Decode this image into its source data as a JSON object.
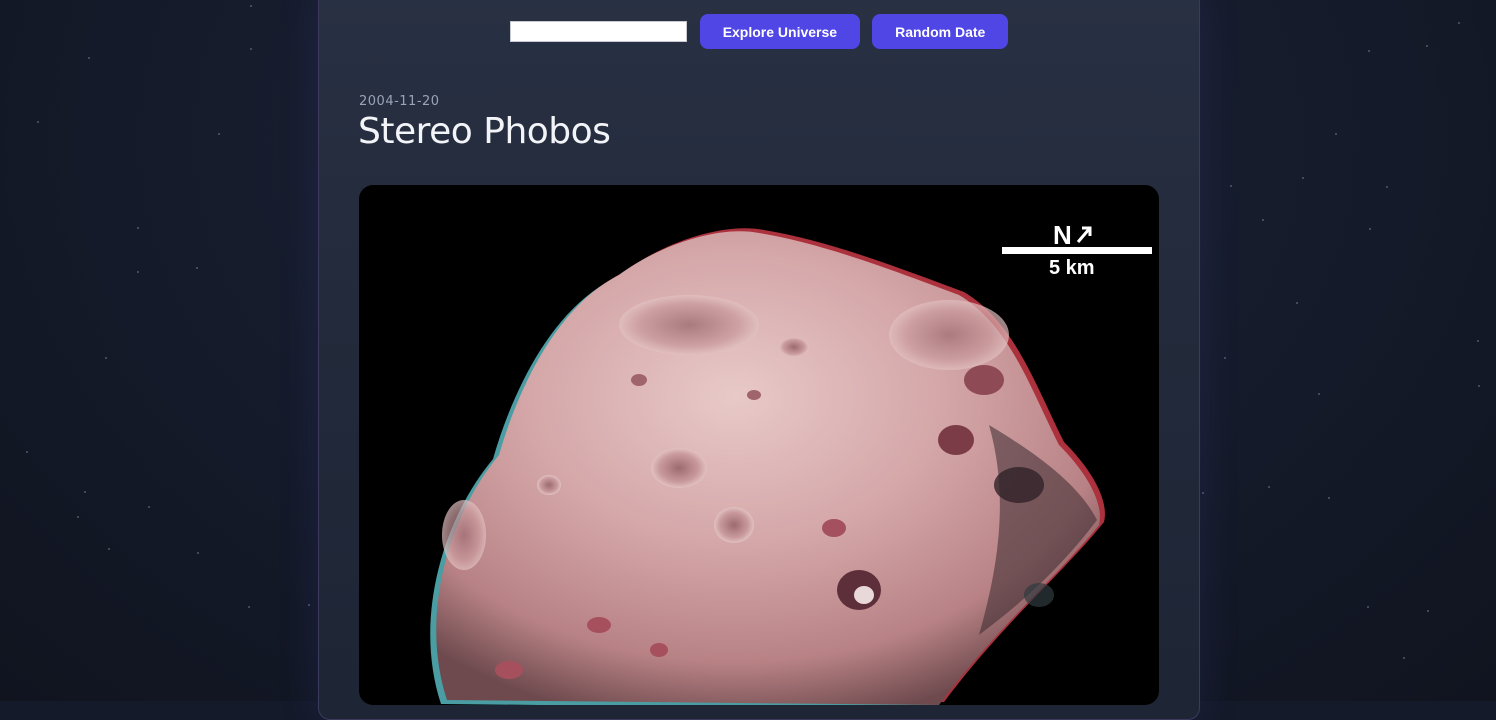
{
  "controls": {
    "date_input_value": "",
    "explore_label": "Explore Universe",
    "random_label": "Random Date"
  },
  "apod": {
    "date": "2004-11-20",
    "title": "Stereo Phobos"
  },
  "image": {
    "compass_label": "N",
    "scale_label": "5 km"
  },
  "colors": {
    "accent": "#4f46e5",
    "background": "#141a29",
    "card": "#262e40"
  }
}
